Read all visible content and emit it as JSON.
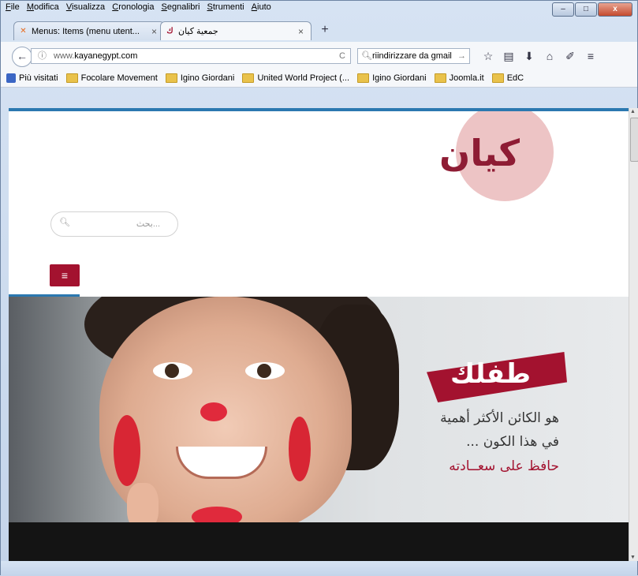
{
  "menubar": {
    "items": [
      "File",
      "Modifica",
      "Visualizza",
      "Cronologia",
      "Segnalibri",
      "Strumenti",
      "Aiuto"
    ]
  },
  "window_controls": {
    "minimize": "–",
    "maximize": "□",
    "close": "x"
  },
  "tabs": [
    {
      "label": "Menus: Items (menu utent...",
      "icon": "joomla-icon",
      "close": "×"
    },
    {
      "label": "جمعية كيان",
      "icon": "kayan-icon",
      "close": "×"
    }
  ],
  "new_tab": "+",
  "nav": {
    "url_prefix": "www.",
    "url_domain": "kayanegypt.com",
    "search_value": "riindirizzare da gmail",
    "back": "←",
    "info": "ⓘ",
    "reload": "C",
    "search_go": "→",
    "tool_icons": [
      "☆",
      "▤",
      "⬇",
      "⌂",
      "✐",
      "≡"
    ]
  },
  "bookmarks": [
    "Più visitati",
    "Focolare Movement",
    "Igino Giordani",
    "United World Project (...",
    "Igino Giordani",
    "Joomla.it",
    "EdC"
  ],
  "site": {
    "logo": "كيان",
    "search_placeholder": "بحث...",
    "menu_icon": "≡",
    "hero": {
      "ribbon": "طفلك",
      "line1": "هو الكائن الأكثر أهمية",
      "line2": "في هذا الكون ...",
      "line3": "حافظ على سعــادته"
    }
  },
  "colors": {
    "brand": "#a3122f",
    "accent": "#2b78b0",
    "logo_circle": "#edc4c5"
  }
}
